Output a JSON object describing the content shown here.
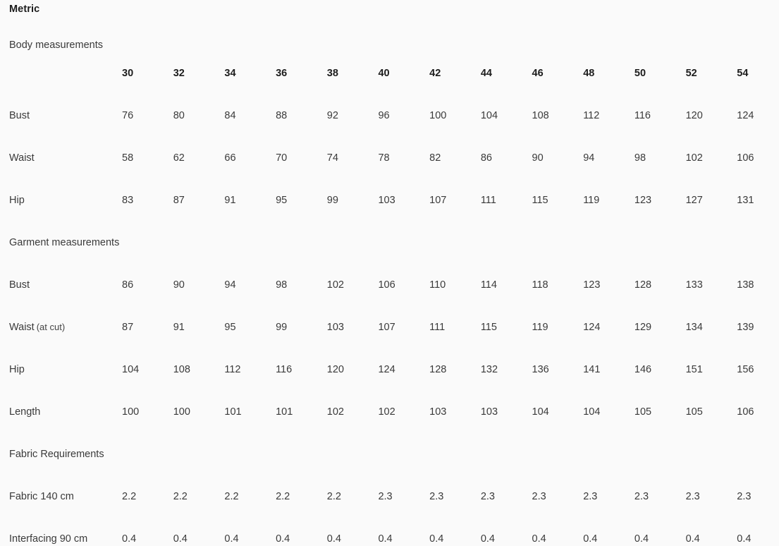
{
  "unit_title": "Metric",
  "header": {
    "row_label": "Body measurements",
    "sizes": [
      "30",
      "32",
      "34",
      "36",
      "38",
      "40",
      "42",
      "44",
      "46",
      "48",
      "50",
      "52",
      "54"
    ]
  },
  "sections": [
    {
      "id": "body-measurements",
      "heading": null,
      "rows": [
        {
          "label": "Bust",
          "sub": "",
          "values": [
            "76",
            "80",
            "84",
            "88",
            "92",
            "96",
            "100",
            "104",
            "108",
            "112",
            "116",
            "120",
            "124"
          ]
        },
        {
          "label": "Waist",
          "sub": "",
          "values": [
            "58",
            "62",
            "66",
            "70",
            "74",
            "78",
            "82",
            "86",
            "90",
            "94",
            "98",
            "102",
            "106"
          ]
        },
        {
          "label": "Hip",
          "sub": "",
          "values": [
            "83",
            "87",
            "91",
            "95",
            "99",
            "103",
            "107",
            "111",
            "115",
            "119",
            "123",
            "127",
            "131"
          ]
        }
      ]
    },
    {
      "id": "garment-measurements",
      "heading": "Garment measurements",
      "rows": [
        {
          "label": "Bust",
          "sub": "",
          "values": [
            "86",
            "90",
            "94",
            "98",
            "102",
            "106",
            "110",
            "114",
            "118",
            "123",
            "128",
            "133",
            "138"
          ]
        },
        {
          "label": "Waist",
          "sub": "(at cut)",
          "values": [
            "87",
            "91",
            "95",
            "99",
            "103",
            "107",
            "111",
            "115",
            "119",
            "124",
            "129",
            "134",
            "139"
          ]
        },
        {
          "label": "Hip",
          "sub": "",
          "values": [
            "104",
            "108",
            "112",
            "116",
            "120",
            "124",
            "128",
            "132",
            "136",
            "141",
            "146",
            "151",
            "156"
          ]
        },
        {
          "label": "Length",
          "sub": "",
          "values": [
            "100",
            "100",
            "101",
            "101",
            "102",
            "102",
            "103",
            "103",
            "104",
            "104",
            "105",
            "105",
            "106"
          ]
        }
      ]
    },
    {
      "id": "fabric-requirements",
      "heading": "Fabric Requirements",
      "rows": [
        {
          "label": "Fabric 140 cm",
          "sub": "",
          "values": [
            "2.2",
            "2.2",
            "2.2",
            "2.2",
            "2.2",
            "2.3",
            "2.3",
            "2.3",
            "2.3",
            "2.3",
            "2.3",
            "2.3",
            "2.3"
          ]
        },
        {
          "label": "Interfacing 90 cm",
          "sub": "",
          "values": [
            "0.4",
            "0.4",
            "0.4",
            "0.4",
            "0.4",
            "0.4",
            "0.4",
            "0.4",
            "0.4",
            "0.4",
            "0.4",
            "0.4",
            "0.4"
          ]
        }
      ]
    }
  ],
  "colors": {
    "background": "#fafafa",
    "heading_text": "#1c1c1c",
    "body_text": "#3a3a3a"
  }
}
